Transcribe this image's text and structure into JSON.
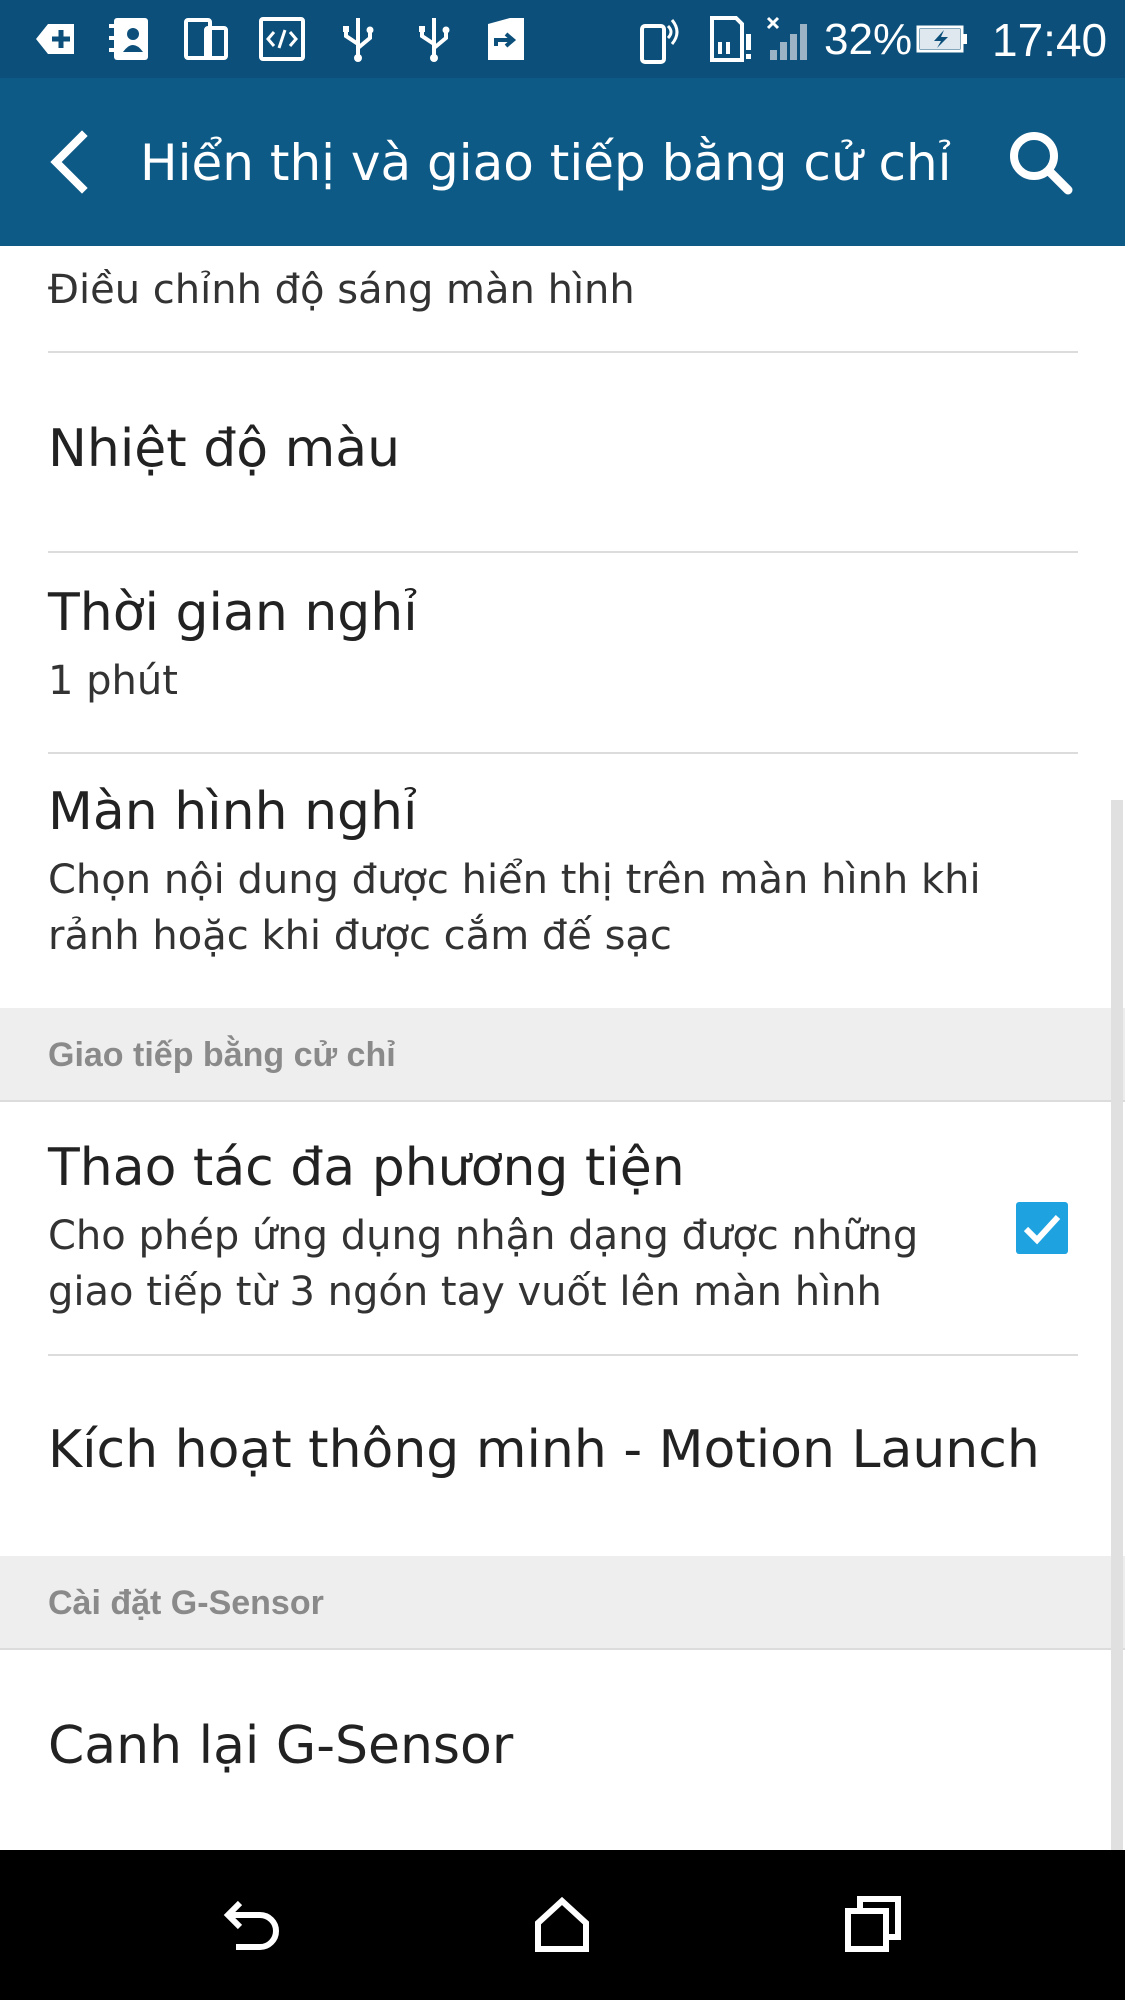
{
  "status_bar": {
    "battery_percent": "32%",
    "time": "17:40",
    "icons": [
      "add-box-icon",
      "contacts-icon",
      "devices-icon",
      "code-icon",
      "usb-icon",
      "usb-icon",
      "forward-file-icon",
      "phone-vibrate-icon",
      "sd-card-alert-icon",
      "no-signal-icon",
      "battery-charging-icon"
    ]
  },
  "app_bar": {
    "title": "Hiển thị và giao tiếp bằng cử chỉ",
    "back_icon": "back-arrow-icon",
    "search_icon": "search-icon"
  },
  "list": {
    "partial_item": {
      "subtitle": "Điều chỉnh độ sáng màn hình"
    },
    "color_temperature": {
      "title": "Nhiệt độ màu"
    },
    "sleep": {
      "title": "Thời gian nghỉ",
      "subtitle": "1 phút"
    },
    "daydream": {
      "title": "Màn hình nghỉ",
      "subtitle": "Chọn nội dung được hiển thị trên màn hình khi rảnh hoặc khi được cắm đế sạc"
    },
    "section_gestures": {
      "label": "Giao tiếp bằng cử chỉ"
    },
    "multimedia_gesture": {
      "title": "Thao tác đa phương tiện",
      "subtitle": "Cho phép ứng dụng nhận dạng được những giao tiếp từ 3 ngón tay vuốt lên màn hình",
      "checked": true
    },
    "motion_launch": {
      "title": "Kích hoạt thông minh - Motion Launch"
    },
    "section_gsensor": {
      "label": "Cài đặt G-Sensor"
    },
    "calibrate": {
      "title": "Canh lại G-Sensor"
    }
  },
  "nav_bar": {
    "icons": [
      "back-icon",
      "home-icon",
      "recents-icon"
    ]
  },
  "colors": {
    "status_bar": "#0b4f7a",
    "app_bar": "#0d5a87",
    "accent": "#1fa3e0",
    "section_bg": "#eeeeee"
  }
}
